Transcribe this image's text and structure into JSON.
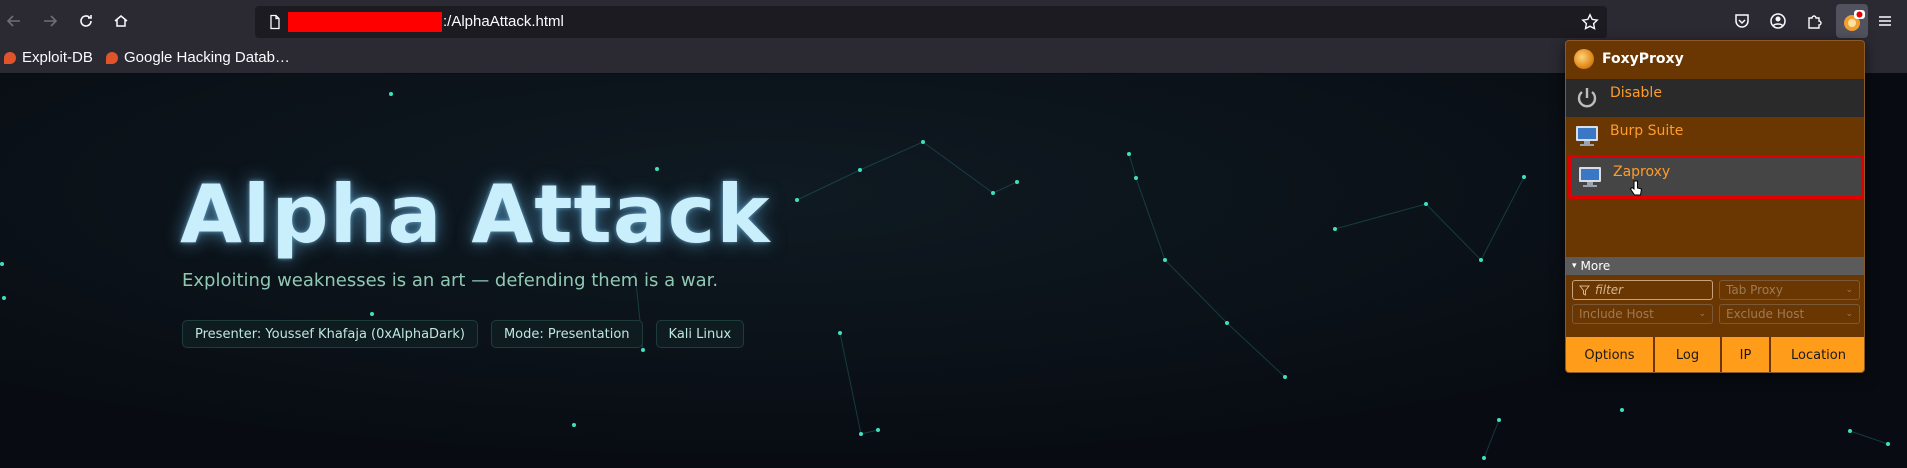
{
  "browser": {
    "url_suffix": ":/AlphaAttack.html",
    "bookmarks": [
      {
        "label": "Exploit-DB"
      },
      {
        "label": "Google Hacking Datab…"
      }
    ]
  },
  "page": {
    "title": "Alpha Attack",
    "subtitle": "Exploiting weaknesses is an art — defending them is a war.",
    "chips": [
      "Presenter: Youssef Khafaja (0xAlphaDark)",
      "Mode: Presentation",
      "Kali Linux"
    ]
  },
  "foxyproxy": {
    "title": "FoxyProxy",
    "items": [
      {
        "label": "Disable",
        "icon": "power-icon"
      },
      {
        "label": "Burp Suite",
        "icon": "monitor-icon"
      },
      {
        "label": "Zaproxy",
        "icon": "monitor-icon"
      }
    ],
    "more_label": "More",
    "filter_placeholder": "filter",
    "tab_proxy": "Tab Proxy",
    "include_host": "Include Host",
    "exclude_host": "Exclude Host",
    "footer": [
      "Options",
      "Log",
      "IP",
      "Location"
    ]
  },
  "colors": {
    "accent": "#ff9c1a",
    "popup_bg": "#6a3703",
    "highlight_border": "#e00000",
    "title_glow": "#c9eefc"
  }
}
